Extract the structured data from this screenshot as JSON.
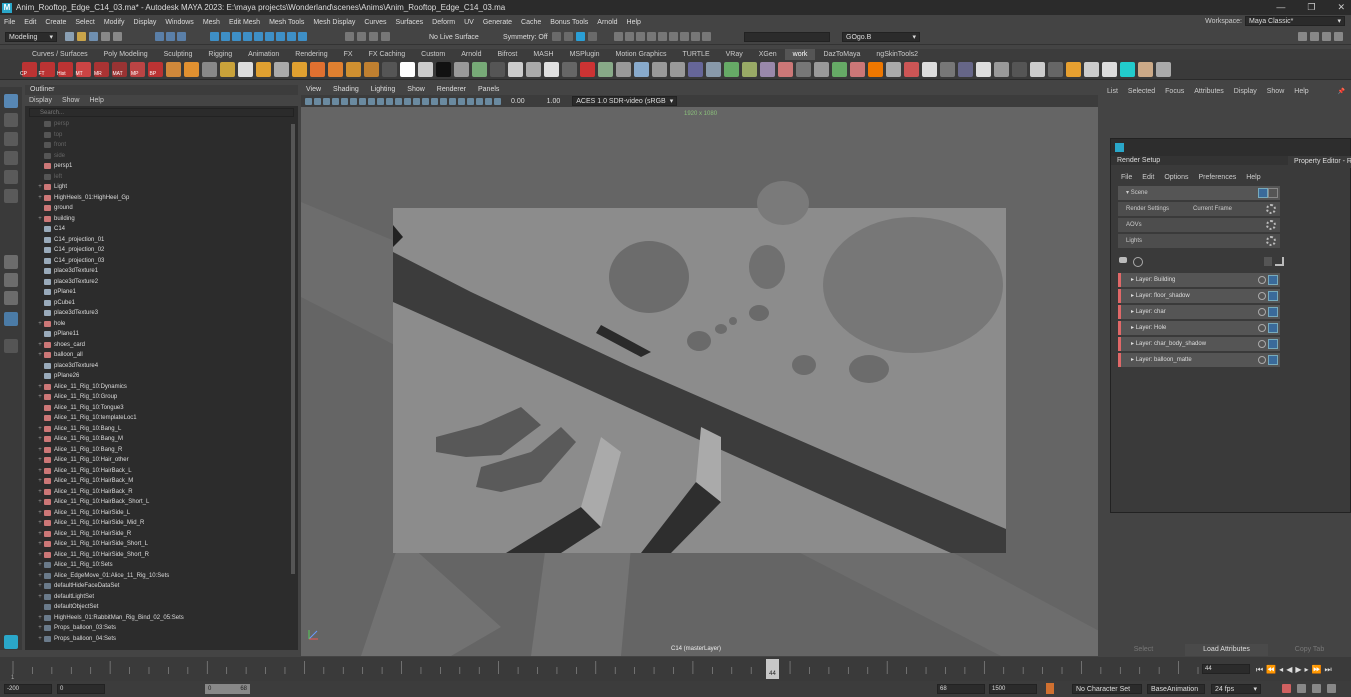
{
  "app": {
    "window_title": "Anim_Rooftop_Edge_C14_03.ma* - Autodesk MAYA 2023: E:\\maya projects\\Wonderland\\scenes\\Anims\\Anim_Rooftop_Edge_C14_03.ma",
    "logo_letter": "M",
    "window_controls": [
      "—",
      "❐",
      "✕"
    ]
  },
  "menubar": {
    "items": [
      "File",
      "Edit",
      "Create",
      "Select",
      "Modify",
      "Display",
      "Windows",
      "Mesh",
      "Edit Mesh",
      "Mesh Tools",
      "Mesh Display",
      "Curves",
      "Surfaces",
      "Deform",
      "UV",
      "Generate",
      "Cache",
      "Bonus Tools",
      "Arnold",
      "Help"
    ],
    "workspace_label": "Workspace:",
    "workspace_value": "Maya Classic*"
  },
  "statusline": {
    "mode": "Modeling",
    "live_surface": "No Live Surface",
    "symmetry": "Symmetry: Off",
    "camera_field": "GOgo.B"
  },
  "shelf": {
    "tabs": [
      "Curves / Surfaces",
      "Poly Modeling",
      "Sculpting",
      "Rigging",
      "Animation",
      "Rendering",
      "FX",
      "FX Caching",
      "Custom",
      "Arnold",
      "Bifrost",
      "MASH",
      "MSPlugin",
      "Motion Graphics",
      "TURTLE",
      "VRay",
      "XGen",
      "work",
      "DazToMaya",
      "ngSkinTools2"
    ],
    "active_tab": "work",
    "icon_labels": [
      "CP",
      "FT",
      "Hist",
      "MT",
      "MR",
      "MAT",
      "MP",
      "BP"
    ]
  },
  "outliner": {
    "title": "Outliner",
    "menu": [
      "Display",
      "Show",
      "Help"
    ],
    "search_placeholder": "Search...",
    "items": [
      {
        "label": "persp",
        "dim": true,
        "expand": ""
      },
      {
        "label": "top",
        "dim": true,
        "expand": ""
      },
      {
        "label": "front",
        "dim": true,
        "expand": ""
      },
      {
        "label": "side",
        "dim": true,
        "expand": ""
      },
      {
        "label": "persp1",
        "dim": false,
        "expand": ""
      },
      {
        "label": "left",
        "dim": true,
        "expand": ""
      },
      {
        "label": "Light",
        "dim": false,
        "expand": "+"
      },
      {
        "label": "HighHeels_01:HighHeel_Gp",
        "dim": false,
        "expand": "+"
      },
      {
        "label": "ground",
        "dim": false,
        "expand": ""
      },
      {
        "label": "building",
        "dim": false,
        "expand": "+"
      },
      {
        "label": "C14",
        "dim": false,
        "expand": ""
      },
      {
        "label": "C14_projection_01",
        "dim": false,
        "expand": ""
      },
      {
        "label": "C14_projection_02",
        "dim": false,
        "expand": ""
      },
      {
        "label": "C14_projection_03",
        "dim": false,
        "expand": ""
      },
      {
        "label": "place3dTexture1",
        "dim": false,
        "expand": ""
      },
      {
        "label": "place3dTexture2",
        "dim": false,
        "expand": ""
      },
      {
        "label": "pPlane1",
        "dim": false,
        "expand": ""
      },
      {
        "label": "pCube1",
        "dim": false,
        "expand": ""
      },
      {
        "label": "place3dTexture3",
        "dim": false,
        "expand": ""
      },
      {
        "label": "hole",
        "dim": false,
        "expand": "+"
      },
      {
        "label": "pPlane11",
        "dim": false,
        "expand": ""
      },
      {
        "label": "shoes_card",
        "dim": false,
        "expand": "+"
      },
      {
        "label": "balloon_all",
        "dim": false,
        "expand": "+"
      },
      {
        "label": "place3dTexture4",
        "dim": false,
        "expand": ""
      },
      {
        "label": "pPlane26",
        "dim": false,
        "expand": ""
      },
      {
        "label": "Alice_11_Rig_10:Dynamics",
        "dim": false,
        "expand": "+"
      },
      {
        "label": "Alice_11_Rig_10:Group",
        "dim": false,
        "expand": "+"
      },
      {
        "label": "Alice_11_Rig_10:Tongue3",
        "dim": false,
        "expand": ""
      },
      {
        "label": "Alice_11_Rig_10:templateLoc1",
        "dim": false,
        "expand": ""
      },
      {
        "label": "Alice_11_Rig_10:Bang_L",
        "dim": false,
        "expand": "+"
      },
      {
        "label": "Alice_11_Rig_10:Bang_M",
        "dim": false,
        "expand": "+"
      },
      {
        "label": "Alice_11_Rig_10:Bang_R",
        "dim": false,
        "expand": "+"
      },
      {
        "label": "Alice_11_Rig_10:Hair_other",
        "dim": false,
        "expand": "+"
      },
      {
        "label": "Alice_11_Rig_10:HairBack_L",
        "dim": false,
        "expand": "+"
      },
      {
        "label": "Alice_11_Rig_10:HairBack_M",
        "dim": false,
        "expand": "+"
      },
      {
        "label": "Alice_11_Rig_10:HairBack_R",
        "dim": false,
        "expand": "+"
      },
      {
        "label": "Alice_11_Rig_10:HairBack_Short_L",
        "dim": false,
        "expand": "+"
      },
      {
        "label": "Alice_11_Rig_10:HairSide_L",
        "dim": false,
        "expand": "+"
      },
      {
        "label": "Alice_11_Rig_10:HairSide_Mid_R",
        "dim": false,
        "expand": "+"
      },
      {
        "label": "Alice_11_Rig_10:HairSide_R",
        "dim": false,
        "expand": "+"
      },
      {
        "label": "Alice_11_Rig_10:HairSide_Short_L",
        "dim": false,
        "expand": "+"
      },
      {
        "label": "Alice_11_Rig_10:HairSide_Short_R",
        "dim": false,
        "expand": "+"
      },
      {
        "label": "Alice_11_Rig_10:Sets",
        "dim": false,
        "expand": "+"
      },
      {
        "label": "Alice_EdgeMove_01:Alice_11_Rig_10:Sets",
        "dim": false,
        "expand": "+"
      },
      {
        "label": "defaultHideFaceDataSet",
        "dim": false,
        "expand": "+"
      },
      {
        "label": "defaultLightSet",
        "dim": false,
        "expand": "+"
      },
      {
        "label": "defaultObjectSet",
        "dim": false,
        "expand": ""
      },
      {
        "label": "HighHeels_01:RabbitMan_Rig_Bind_02_05:Sets",
        "dim": false,
        "expand": "+"
      },
      {
        "label": "Props_balloon_03:Sets",
        "dim": false,
        "expand": "+"
      },
      {
        "label": "Props_balloon_04:Sets",
        "dim": false,
        "expand": "+"
      }
    ]
  },
  "viewport": {
    "menu": [
      "View",
      "Shading",
      "Lighting",
      "Show",
      "Renderer",
      "Panels"
    ],
    "exposure": "0.00",
    "gamma": "1.00",
    "colorspace": "ACES 1.0 SDR-video (sRGB",
    "resolution_label": "1920 x 1080",
    "camera_label": "C14 (masterLayer)"
  },
  "right_panel": {
    "menu": [
      "List",
      "Selected",
      "Focus",
      "Attributes",
      "Display",
      "Show",
      "Help"
    ],
    "bottom_buttons": [
      "Select",
      "Load Attributes",
      "Copy Tab"
    ]
  },
  "render_setup": {
    "title": "Render Setup",
    "menu": [
      "File",
      "Edit",
      "Options",
      "Preferences",
      "Help"
    ],
    "scene_label": "Scene",
    "scene_rows": [
      {
        "label": "Render Settings",
        "value": "Current Frame"
      },
      {
        "label": "AOVs",
        "value": ""
      },
      {
        "label": "Lights",
        "value": ""
      }
    ],
    "layers": [
      "Layer:  Building",
      "Layer:  floor_shadow",
      "Layer:  char",
      "Layer:  Hole",
      "Layer:  char_body_shadow",
      "Layer:  balloon_matte"
    ],
    "property_editor_title": "Property Editor - Ren"
  },
  "timeline": {
    "ticks": [
      "1",
      "",
      "",
      "",
      "",
      "",
      "",
      "",
      "",
      "",
      "",
      "",
      "",
      "",
      "",
      "",
      "",
      "",
      "",
      "",
      "",
      "",
      "",
      "",
      "",
      "",
      "",
      "",
      "",
      "",
      "",
      "",
      "",
      "",
      "",
      "",
      "",
      "",
      "",
      "",
      "",
      "",
      "",
      "",
      "",
      "",
      "",
      "",
      "",
      "",
      "",
      "",
      "",
      "",
      "",
      "",
      "",
      "",
      "",
      "",
      "",
      ""
    ],
    "current_frame_marker": "44",
    "current_frame_field": "44"
  },
  "range": {
    "start": "-200",
    "inner_start": "0",
    "slider_a": "0",
    "slider_b": "68",
    "end": "68",
    "outer_end": "1500",
    "character_set": "No Character Set",
    "anim_layer": "BaseAnimation",
    "fps": "24 fps"
  }
}
